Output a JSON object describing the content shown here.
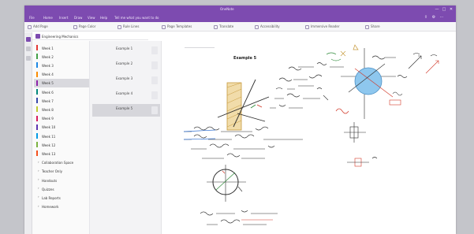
{
  "window": {
    "app_title": "OneNote",
    "account": "",
    "controls": [
      "—",
      "□",
      "✕"
    ]
  },
  "menubar": {
    "items": [
      "File",
      "Home",
      "Insert",
      "Draw",
      "View",
      "Help"
    ],
    "tell_me": "Tell me what you want to do"
  },
  "toolbar": {
    "items": [
      "Add Page",
      "Page Color",
      "Rule Lines",
      "Page Templates",
      "Translate",
      "Accessibility",
      "Immersive Reader",
      "Share"
    ]
  },
  "notebook": {
    "name": "Engineering Mechanics",
    "icon": "notebook-icon",
    "color": "#7d4bb0"
  },
  "sections": [
    {
      "label": "Week 1",
      "color": "#e53935"
    },
    {
      "label": "Week 2",
      "color": "#43a047"
    },
    {
      "label": "Week 3",
      "color": "#1e88e5"
    },
    {
      "label": "Week 4",
      "color": "#fb8c00"
    },
    {
      "label": "Week 5",
      "color": "#8e24aa"
    },
    {
      "label": "Week 6",
      "color": "#00897b"
    },
    {
      "label": "Week 7",
      "color": "#3949ab"
    },
    {
      "label": "Week 8",
      "color": "#c0ca33"
    },
    {
      "label": "Week 9",
      "color": "#d81b60"
    },
    {
      "label": "Week 10",
      "color": "#5e35b1"
    },
    {
      "label": "Week 11",
      "color": "#039be5"
    },
    {
      "label": "Week 12",
      "color": "#7cb342"
    },
    {
      "label": "Week 13",
      "color": "#f4511e"
    }
  ],
  "section_groups": [
    {
      "label": "Collaboration Space"
    },
    {
      "label": "Teacher Only"
    },
    {
      "label": "Handouts"
    },
    {
      "label": "Quizzes"
    },
    {
      "label": "Lab Reports"
    },
    {
      "label": "Homework"
    }
  ],
  "active_section": 4,
  "pages": [
    {
      "title": "Example 1",
      "subtitle": ""
    },
    {
      "title": "Example 2",
      "subtitle": ""
    },
    {
      "title": "Example 3",
      "subtitle": ""
    },
    {
      "title": "Example 4",
      "subtitle": ""
    },
    {
      "title": "Example 5",
      "subtitle": ""
    }
  ],
  "active_page": 4,
  "canvas": {
    "page_tab": "",
    "heading": "Example 5",
    "paragraph": ""
  },
  "colors": {
    "accent": "#7d4bb0",
    "ink_black": "#2b2b2b",
    "ink_green": "#2f8a3a",
    "ink_red": "#d23a2a",
    "ink_blue": "#2f6fd0",
    "circle_fill": "#8ec7ee",
    "hatch": "#d7b25a"
  }
}
